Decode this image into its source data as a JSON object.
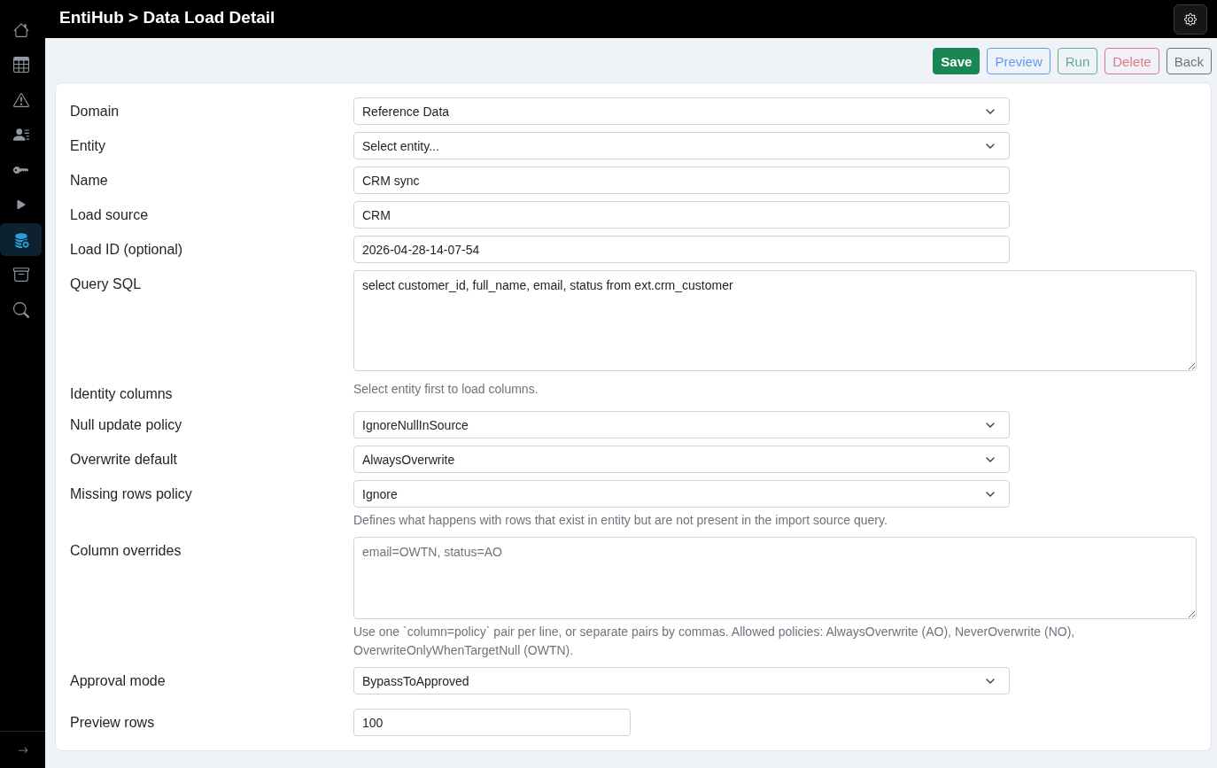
{
  "header": {
    "title": "EntiHub > Data Load Detail"
  },
  "sidebar": {
    "items": [
      {
        "selected": false
      },
      {
        "selected": false
      },
      {
        "selected": false
      },
      {
        "selected": false
      },
      {
        "selected": false
      },
      {
        "selected": false
      },
      {
        "selected": true
      },
      {
        "selected": false
      },
      {
        "selected": false
      }
    ]
  },
  "toolbar": {
    "buttons": [
      {
        "label": "Save",
        "kind": "success",
        "filled": true,
        "disabled": false
      },
      {
        "label": "Preview",
        "kind": "primary",
        "filled": false,
        "disabled": true
      },
      {
        "label": "Run",
        "kind": "success",
        "filled": false,
        "disabled": true
      },
      {
        "label": "Delete",
        "kind": "danger",
        "filled": false,
        "disabled": true
      },
      {
        "label": "Back",
        "kind": "secondary",
        "filled": false,
        "disabled": false
      }
    ]
  },
  "form": {
    "fields": [
      {
        "label": "Domain",
        "kind": "select",
        "value": "Reference Data"
      },
      {
        "label": "Entity",
        "kind": "select",
        "value": "Select entity..."
      },
      {
        "label": "Name",
        "kind": "input",
        "value": "CRM sync"
      },
      {
        "label": "Load source",
        "kind": "input",
        "value": "CRM"
      },
      {
        "label": "Load ID (optional)",
        "kind": "input",
        "value": "2026-04-28-14-07-54"
      },
      {
        "label": "Query SQL",
        "kind": "query",
        "value": "select customer_id, full_name, email, status from ext.crm_customer"
      },
      {
        "label": "Identity columns",
        "kind": "note",
        "help": "Select entity first to load columns."
      },
      {
        "label": "Null update policy",
        "kind": "select",
        "value": "IgnoreNullInSource"
      },
      {
        "label": "Overwrite default",
        "kind": "select",
        "value": "AlwaysOverwrite"
      },
      {
        "label": "Missing rows policy",
        "kind": "select",
        "value": "Ignore",
        "help": "Defines what happens with rows that exist in entity but are not present in the import source query."
      },
      {
        "label": "Column overrides",
        "kind": "textarea",
        "placeholder": "email=OWTN, status=AO",
        "help": "Use one `column=policy` pair per line, or separate pairs by commas. Allowed policies: AlwaysOverwrite (AO), NeverOverwrite (NO), OverwriteOnlyWhenTargetNull (OWTN)."
      },
      {
        "label": "Approval mode",
        "kind": "select",
        "value": "BypassToApproved"
      },
      {
        "label": "Preview rows",
        "kind": "number",
        "value": "100"
      }
    ]
  }
}
